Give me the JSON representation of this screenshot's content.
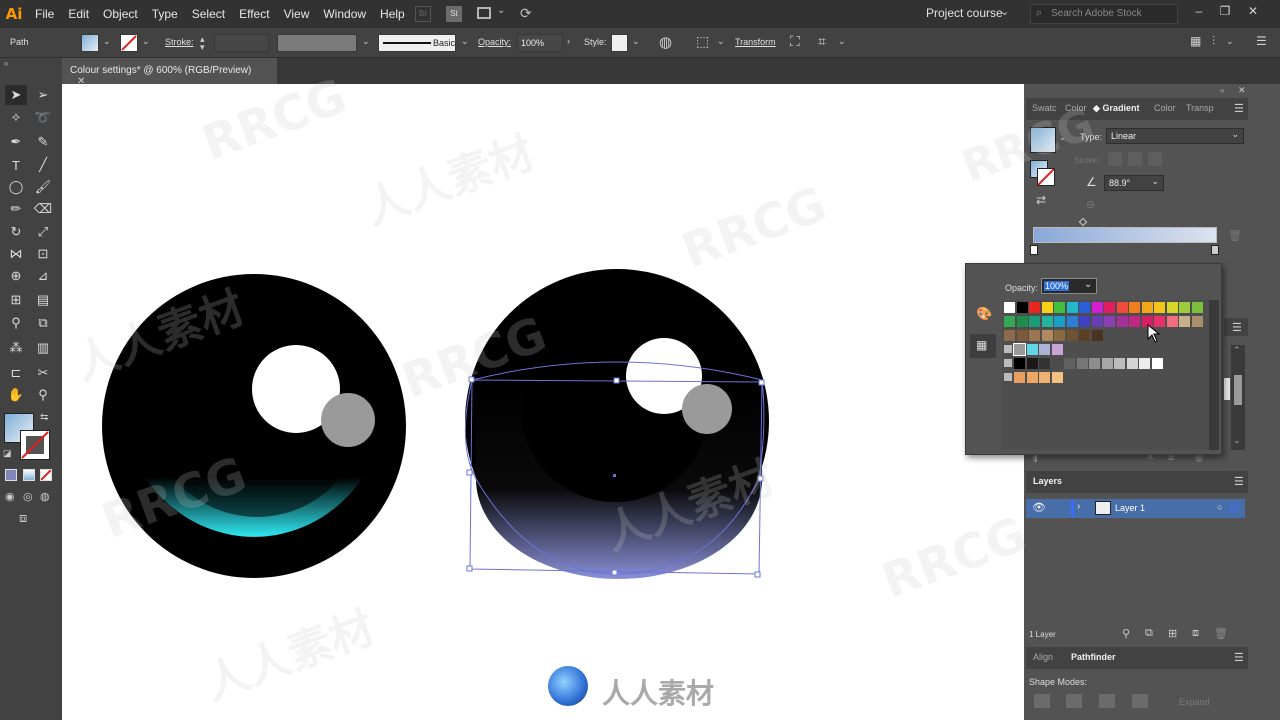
{
  "app": {
    "logo": "Ai"
  },
  "menu": [
    "File",
    "Edit",
    "Object",
    "Type",
    "Select",
    "Effect",
    "View",
    "Window",
    "Help"
  ],
  "workspace": "Project course",
  "search": {
    "placeholder": "Search Adobe Stock"
  },
  "control": {
    "object_type": "Path",
    "stroke_label": "Stroke:",
    "brush_label": "Basic",
    "opacity_label": "Opacity:",
    "opacity_value": "100%",
    "style_label": "Style:",
    "transform_label": "Transform"
  },
  "document": {
    "tab_title": "Colour settings* @ 600% (RGB/Preview)"
  },
  "gradient_panel": {
    "tabs": [
      "Swatc",
      "Color",
      "Gradient",
      "Color",
      "Transp"
    ],
    "type_label": "Type:",
    "type_value": "Linear",
    "stroke_label": "Stroke:",
    "angle_value": "88.9°"
  },
  "swatch_popup": {
    "opacity_label": "Opacity:",
    "opacity_value": "100%"
  },
  "layers_panel": {
    "title": "Layers",
    "layer_name": "Layer 1",
    "footer": "1 Layer"
  },
  "align_panel": {
    "tabs": [
      "Align",
      "Pathfinder"
    ],
    "shape_modes_label": "Shape Modes:",
    "expand_label": "Expand"
  },
  "colors": {
    "menubar": "#323232",
    "panel": "#535353",
    "selection": "#5a6fd0",
    "highlight_text": "#2f6fd6",
    "layer_color": "#3d6cff"
  },
  "watermarks": [
    "RRCG",
    "人人素材"
  ]
}
